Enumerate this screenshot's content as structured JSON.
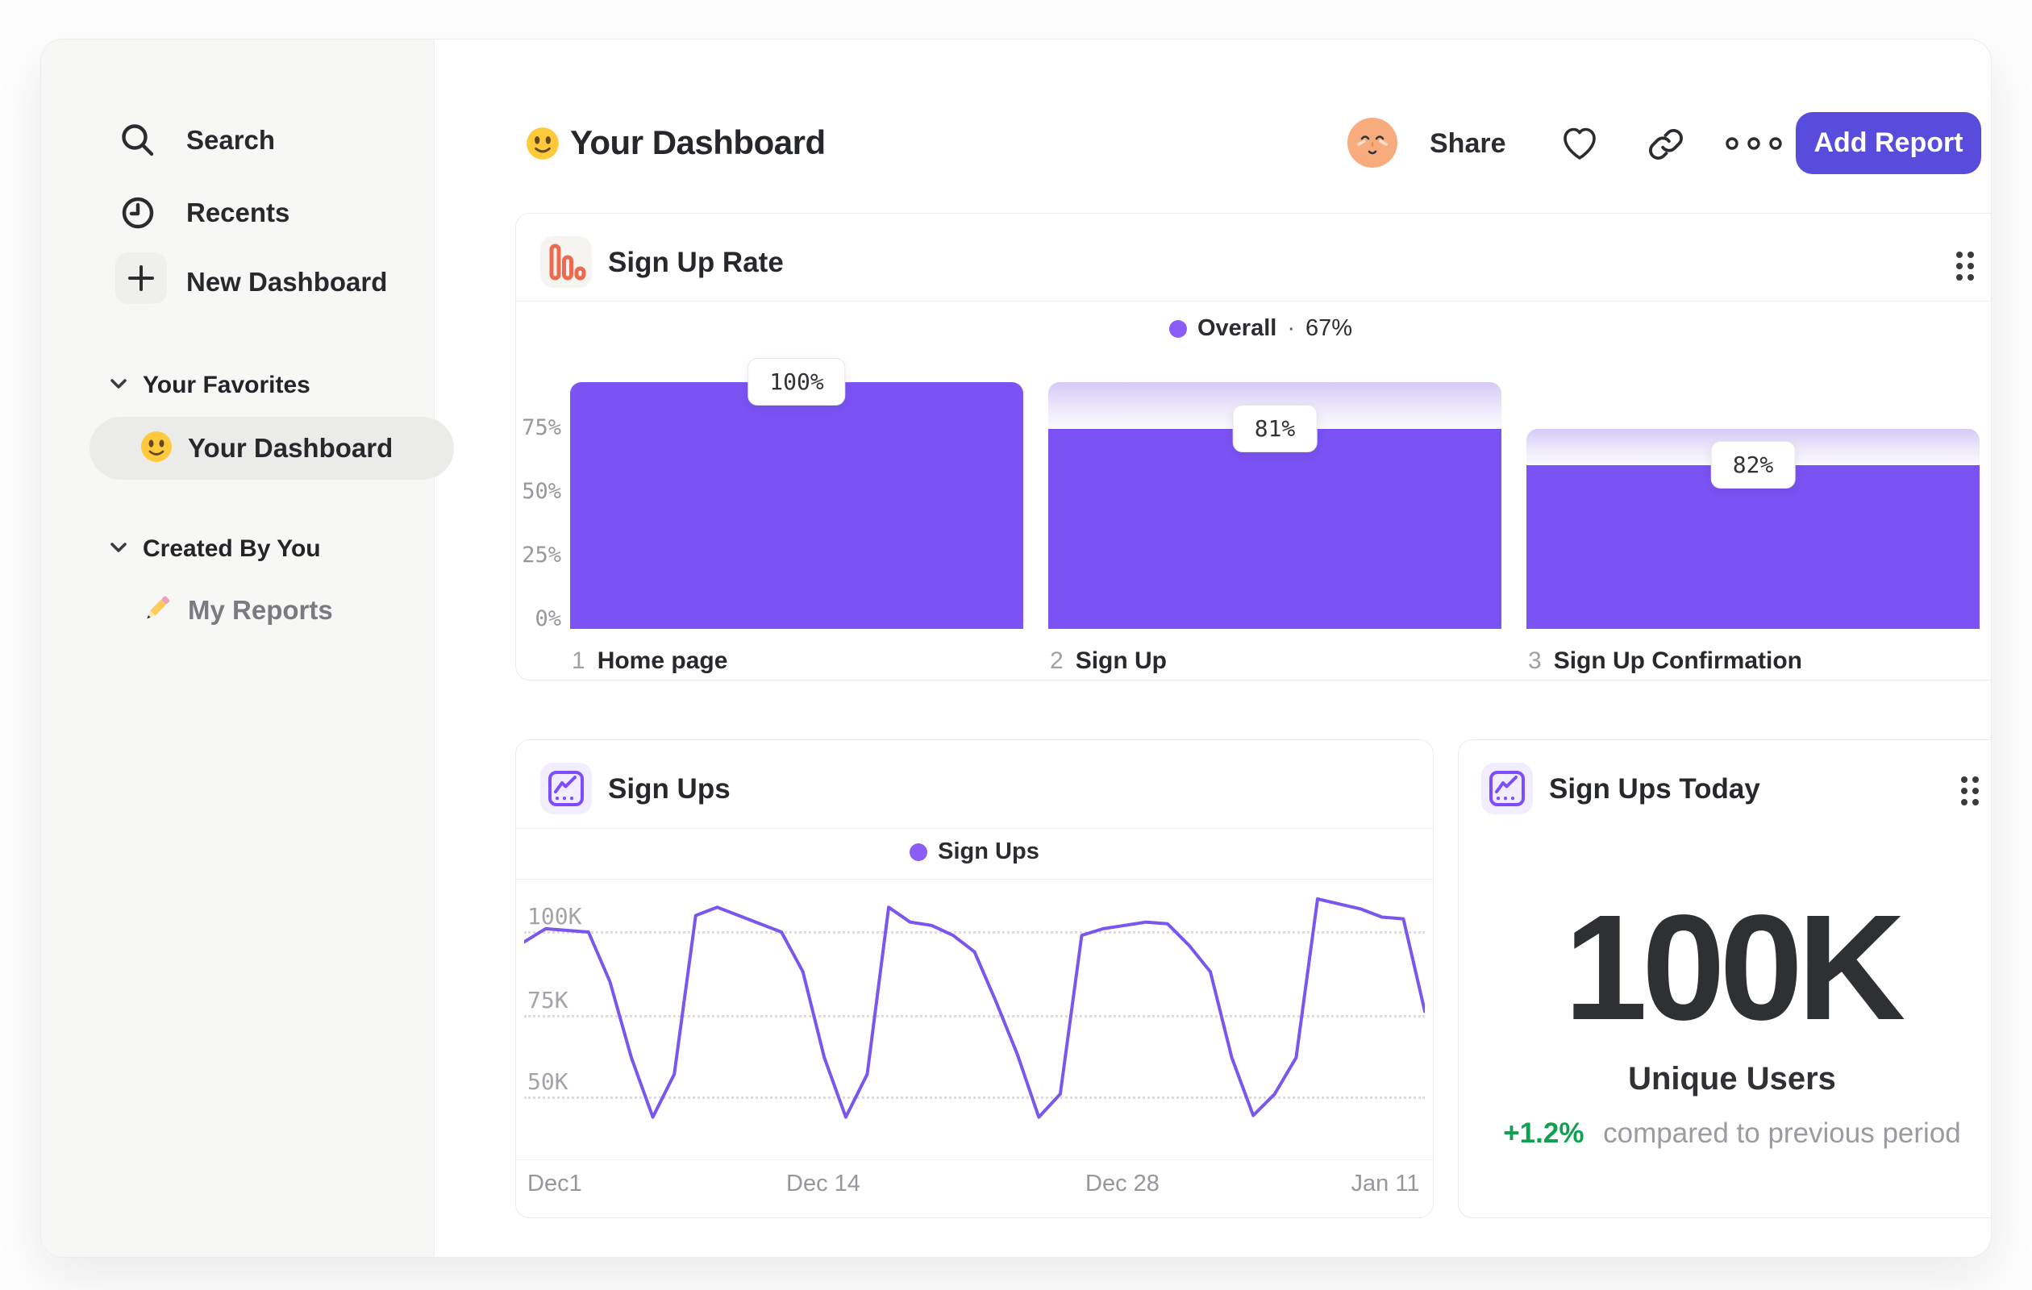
{
  "header": {
    "title": "Your Dashboard",
    "share": "Share",
    "add_report": "Add Report"
  },
  "sidebar": {
    "nav": [
      {
        "label": "Search"
      },
      {
        "label": "Recents"
      },
      {
        "label": "New Dashboard"
      }
    ],
    "sections": [
      {
        "title": "Your Favorites",
        "items": [
          {
            "label": "Your Dashboard",
            "selected": true
          }
        ]
      },
      {
        "title": "Created By You",
        "items": [
          {
            "label": "My Reports"
          }
        ]
      }
    ]
  },
  "signup_rate": {
    "title": "Sign Up Rate",
    "legend": {
      "label": "Overall",
      "sep": "·",
      "value": "67%"
    },
    "yticks": [
      "75%",
      "50%",
      "25%",
      "0%"
    ],
    "steps": [
      {
        "num": "1",
        "label": "Home page",
        "chip": "100%"
      },
      {
        "num": "2",
        "label": "Sign Up",
        "chip": "81%"
      },
      {
        "num": "3",
        "label": "Sign Up Confirmation",
        "chip": "82%"
      }
    ]
  },
  "signups": {
    "title": "Sign Ups",
    "legend": "Sign Ups",
    "yticks": [
      "100K",
      "75K",
      "50K"
    ],
    "xticks": [
      "Dec1",
      "Dec 14",
      "Dec 28",
      "Jan 11"
    ]
  },
  "signups_today": {
    "title": "Sign Ups Today",
    "value": "100K",
    "subtitle": "Unique Users",
    "delta": "+1.2%",
    "note": "compared to previous period"
  },
  "colors": {
    "accent_purple": "#7B52F4",
    "legend_dot": "#8B5CF6",
    "line_stroke": "#7A56EE",
    "button_purple": "#584CDC",
    "delta_green": "#0FA050",
    "funnel_icon_orange": "#EE6A4F",
    "avatar_peach": "#F8AC7E"
  },
  "chart_data": [
    {
      "type": "bar",
      "title": "Sign Up Rate",
      "categories": [
        "Home page",
        "Sign Up",
        "Sign Up Confirmation"
      ],
      "values": [
        100,
        81,
        82
      ],
      "absolute_heights_pct": [
        100,
        81,
        66.4
      ],
      "prev_step_heights_pct": [
        100,
        100,
        81
      ],
      "overall_pct": 67,
      "yticks": [
        "0%",
        "25%",
        "50%",
        "75%"
      ],
      "ylim": [
        0,
        100
      ],
      "grid": false,
      "legend": "Overall · 67%"
    },
    {
      "type": "line",
      "title": "Sign Ups",
      "series": [
        {
          "name": "Sign Ups",
          "values": [
            97,
            101,
            100.5,
            100,
            85,
            62,
            44,
            57,
            105,
            107.5,
            105,
            102.5,
            100,
            88,
            62,
            44,
            57,
            107.5,
            103,
            102,
            99,
            94,
            79,
            63,
            44,
            51,
            99,
            101,
            102,
            103,
            102.5,
            96,
            88,
            62,
            44.5,
            51,
            62,
            110,
            108.5,
            107,
            104.5,
            104,
            76
          ]
        }
      ],
      "unit": "K signups per day",
      "xticks": [
        "Dec1",
        "Dec 14",
        "Dec 28",
        "Jan 11"
      ],
      "yticks": [
        "50K",
        "75K",
        "100K"
      ],
      "ylim": [
        40,
        115
      ],
      "grid": "dotted-horizontal",
      "legend_position": "top-center"
    }
  ]
}
